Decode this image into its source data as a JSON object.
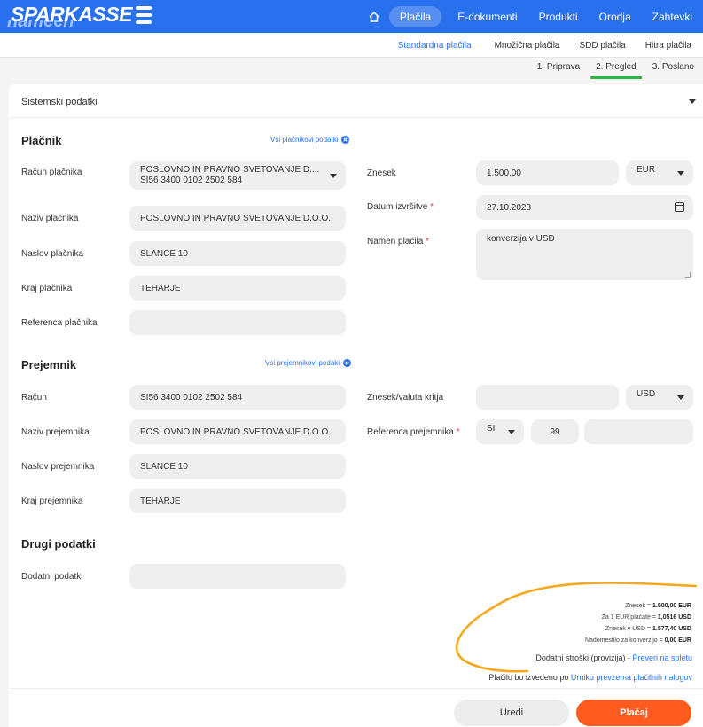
{
  "header": {
    "logo_text": "SPARKASSE",
    "logo_tagline": "nameen reduction",
    "nav": [
      {
        "label": "Plačila",
        "active": true
      },
      {
        "label": "E-dokumenti"
      },
      {
        "label": "Produkti"
      },
      {
        "label": "Orodja"
      },
      {
        "label": "Zahtevki"
      }
    ],
    "home_icon": "home-icon"
  },
  "subnav": [
    {
      "label": "Standardna plačila",
      "active": true
    },
    {
      "label": "Množična plačila"
    },
    {
      "label": "SDD plačila"
    },
    {
      "label": "Hitra plačila"
    }
  ],
  "steps": [
    {
      "label": "1. Priprava"
    },
    {
      "label": "2. Pregled",
      "active": true
    },
    {
      "label": "3. Poslano"
    }
  ],
  "system_data": {
    "label": "Sistemski podatki"
  },
  "payer": {
    "title": "Plačnik",
    "link": "Vsi plačnikovi podatki",
    "account_label": "Račun plačnika",
    "account_name": "POSLOVNO IN PRAVNO SVETOVANJE D....",
    "account_iban": "SI56 3400 0102 2502 584",
    "name_label": "Naziv plačnika",
    "name_value": "POSLOVNO IN PRAVNO SVETOVANJE D.O.O.",
    "address_label": "Naslov plačnika",
    "address_value": "SLANCE 10",
    "city_label": "Kraj plačnika",
    "city_value": "TEHARJE",
    "reference_label": "Referenca plačnika",
    "reference_value": ""
  },
  "payment": {
    "amount_label": "Znesek",
    "amount_value": "1.500,00",
    "currency": "EUR",
    "date_label": "Datum izvršitve",
    "date_value": "27.10.2023",
    "purpose_label": "Namen plačila",
    "purpose_value": "konverzija v USD",
    "required_mark": "*"
  },
  "recipient": {
    "title": "Prejemnik",
    "link": "Vsi prejemnikovi podaki",
    "account_label": "Račun",
    "account_value": "SI56 3400 0102 2502 584",
    "name_label": "Naziv prejemnika",
    "name_value": "POSLOVNO IN PRAVNO SVETOVANJE D.O.O.",
    "address_label": "Naslov prejemnika",
    "address_value": "SLANCE 10",
    "city_label": "Kraj prejemnika",
    "city_value": "TEHARJE",
    "cover_label": "Znesek/valuta kritja",
    "cover_value": "",
    "cover_currency": "USD",
    "reference_label": "Referenca prejemnika",
    "reference_model_prefix": "SI",
    "reference_model": "99",
    "reference_value": ""
  },
  "other": {
    "title": "Drugi podatki",
    "extra_label": "Dodatni podatki",
    "extra_value": ""
  },
  "summary": {
    "amount_label": "Znesek = ",
    "amount_value": "1.500,00 EUR",
    "rate_label": "Za 1 EUR plačate = ",
    "rate_value": "1,0516 USD",
    "usd_label": "Znesek v USD = ",
    "usd_value": "1.577,40 USD",
    "fee_label": "Nadomestilo za konverzijo = ",
    "fee_value": "0,00 EUR",
    "costs_text": "Dodatni stroški (provizija) - ",
    "costs_link": "Preveri na spletu",
    "exec_text": "Plačilo bo izvedeno po ",
    "exec_link": "Urniku prevzema plačilnih nalogov"
  },
  "actions": {
    "edit": "Uredi",
    "pay": "Plačaj"
  },
  "colors": {
    "brand": "#2870ed",
    "pay": "#ff5b1f",
    "step_active": "#31b34a",
    "annotation": "#f6a81c"
  }
}
